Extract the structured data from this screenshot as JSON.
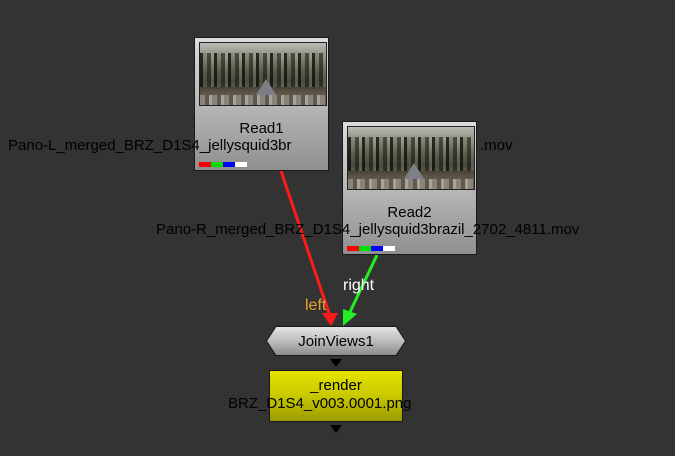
{
  "nodes": {
    "read1": {
      "label": "Read1",
      "file": "Pano-L_merged_BRZ_D1S4_jellysquid3brazil_2702_4811.mov",
      "file_visible_head": "Pano-L_merged_BRZ_D1S4_jellysquid3br",
      "file_visible_tail": ".mov"
    },
    "read2": {
      "label": "Read2",
      "file": "Pano-R_merged_BRZ_D1S4_jellysquid3brazil_2702_4811.mov"
    },
    "joinviews": {
      "label": "JoinViews1"
    },
    "render": {
      "label": "_render",
      "file": "BRZ_D1S4_v003.0001.png"
    }
  },
  "edges": {
    "left": {
      "label": "left",
      "color": "#ff1a1a",
      "label_color": "#e8a030"
    },
    "right": {
      "label": "right",
      "color": "#22ee22",
      "label_color": "#ffffff"
    }
  },
  "channel_colors": [
    "#ff0000",
    "#00e000",
    "#0000ff",
    "#ffffff"
  ],
  "colors": {
    "background": "#333333",
    "render_node": "#c8c800"
  }
}
